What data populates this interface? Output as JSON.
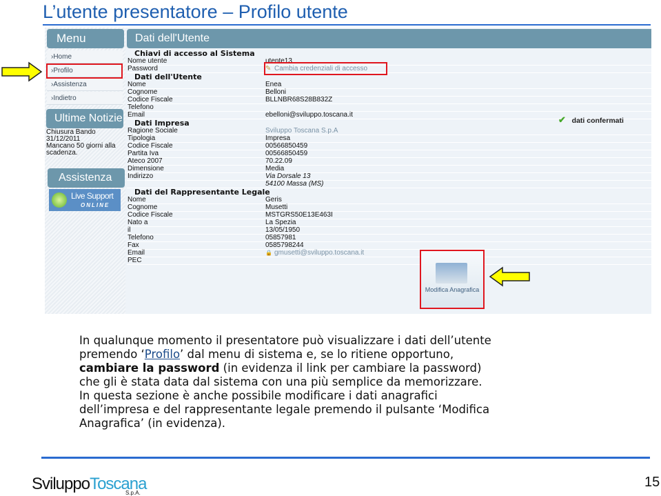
{
  "slide": {
    "title": "L’utente presentatore – Profilo utente",
    "page_number": "15",
    "logo": {
      "part1": "Sviluppo",
      "part2": "Toscana",
      "sub": "S.p.A."
    }
  },
  "app": {
    "menu": {
      "title": "Menu",
      "items": [
        {
          "label": "›Home"
        },
        {
          "label": "›Profilo"
        },
        {
          "label": "›Assistenza"
        },
        {
          "label": "›Indietro"
        }
      ]
    },
    "news": {
      "title": "Ultime Notizie",
      "lines": [
        "Chiusura Bando",
        "31/12/2011",
        "Mancano 50 giorni alla scadenza."
      ]
    },
    "assist": {
      "title": "Assistenza",
      "live_support": "Live Support",
      "online": "ONLINE"
    },
    "main_title": "Dati dell'Utente",
    "sections": [
      {
        "title": "Chiavi di accesso al Sistema",
        "rows": [
          {
            "label": "Nome utente",
            "value": "utente13"
          },
          {
            "label": "Password",
            "value": "Cambia credenziali di accesso"
          }
        ]
      },
      {
        "title": "Dati dell'Utente",
        "rows": [
          {
            "label": "Nome",
            "value": "Enea"
          },
          {
            "label": "Cognome",
            "value": "Belloni"
          },
          {
            "label": "Codice Fiscale",
            "value": "BLLNBR68S28B832Z"
          },
          {
            "label": "Telefono",
            "value": ""
          },
          {
            "label": "Email",
            "value": "ebelloni@sviluppo.toscana.it"
          }
        ]
      },
      {
        "title": "Dati Impresa",
        "rows": [
          {
            "label": "Ragione Sociale",
            "value": "Sviluppo Toscana S.p.A"
          },
          {
            "label": "Tipologia",
            "value": "Impresa"
          },
          {
            "label": "Codice Fiscale",
            "value": "00566850459"
          },
          {
            "label": "Partita Iva",
            "value": "00566850459"
          },
          {
            "label": "Ateco 2007",
            "value": "70.22.09"
          },
          {
            "label": "Dimensione",
            "value": "Media"
          },
          {
            "label": "Indirizzo",
            "value": "Via Dorsale 13"
          },
          {
            "label": "",
            "value": "54100 Massa (MS)"
          }
        ]
      },
      {
        "title": "Dati del Rappresentante Legale",
        "rows": [
          {
            "label": "Nome",
            "value": "Geris"
          },
          {
            "label": "Cognome",
            "value": "Musetti"
          },
          {
            "label": "Codice Fiscale",
            "value": "MSTGRS50E13E463I"
          },
          {
            "label": "Nato a",
            "value": "La Spezia"
          },
          {
            "label": "il",
            "value": "13/05/1950"
          },
          {
            "label": "Telefono",
            "value": "05857981"
          },
          {
            "label": "Fax",
            "value": "0585798244"
          },
          {
            "label": "Email",
            "value": "gmusetti@sviluppo.toscana.it"
          },
          {
            "label": "PEC",
            "value": ""
          }
        ]
      }
    ],
    "confirmed": "dati confermati",
    "modifica": "Modifica Anagrafica"
  },
  "body": {
    "l1": "In qualunque momento il presentatore può visualizzare i dati dell’utente",
    "l2a": "premendo ‘",
    "l2link": "Profilo",
    "l2b": "’ dal menu di sistema e, se lo ritiene opportuno,",
    "l3bold": "cambiare la password",
    "l3": " (in evidenza il link per cambiare la password)",
    "l4": "che gli è stata data dal sistema con una più semplice da memorizzare.",
    "l5": "In questa sezione è anche possibile modificare i dati anagrafici",
    "l6": "dell’impresa e del rappresentante legale premendo il pulsante ‘Modifica",
    "l7": "Anagrafica’ (in evidenza)."
  },
  "colors": {
    "accent": "#1f5fb0",
    "header": "#6d97ab",
    "highlight": "#e0161e",
    "arrow": "#ffff00"
  }
}
